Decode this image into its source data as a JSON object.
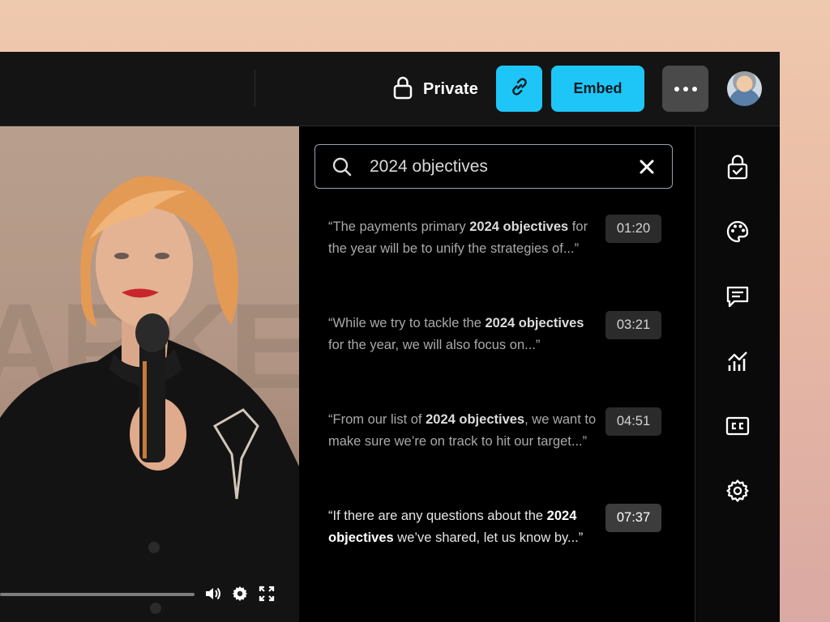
{
  "header": {
    "privacy_label": "Private",
    "embed_label": "Embed",
    "icons": [
      "lock-icon",
      "link-icon",
      "more-icon",
      "avatar"
    ]
  },
  "search": {
    "query": "2024 objectives"
  },
  "results": [
    {
      "before": "“The payments primary ",
      "highlight": "2024 objectives",
      "after": " for the year will be to unify the strategies of...”",
      "time": "01:20"
    },
    {
      "before": "“While we try to tackle the ",
      "highlight": "2024 objectives",
      "after": " for the year, we will also focus on...”",
      "time": "03:21"
    },
    {
      "before": "“From our list of ",
      "highlight": "2024 objectives",
      "after": ", we want to make sure we’re on track to hit our target...”",
      "time": "04:51"
    },
    {
      "before": "“If there are any questions about the ",
      "highlight": "2024 objectives",
      "after": " we’ve shared, let us know by...”",
      "time": "07:37"
    }
  ],
  "video": {
    "background_text": "ARKE",
    "controls": [
      "volume-icon",
      "settings-icon",
      "fullscreen-icon"
    ]
  },
  "rail_icons": [
    "lock-check-icon",
    "palette-icon",
    "comments-icon",
    "analytics-icon",
    "captions-icon",
    "settings-icon"
  ],
  "colors": {
    "accent": "#1ec6f7",
    "panel_bg": "#000000",
    "page_bg": "#efc9ad"
  }
}
